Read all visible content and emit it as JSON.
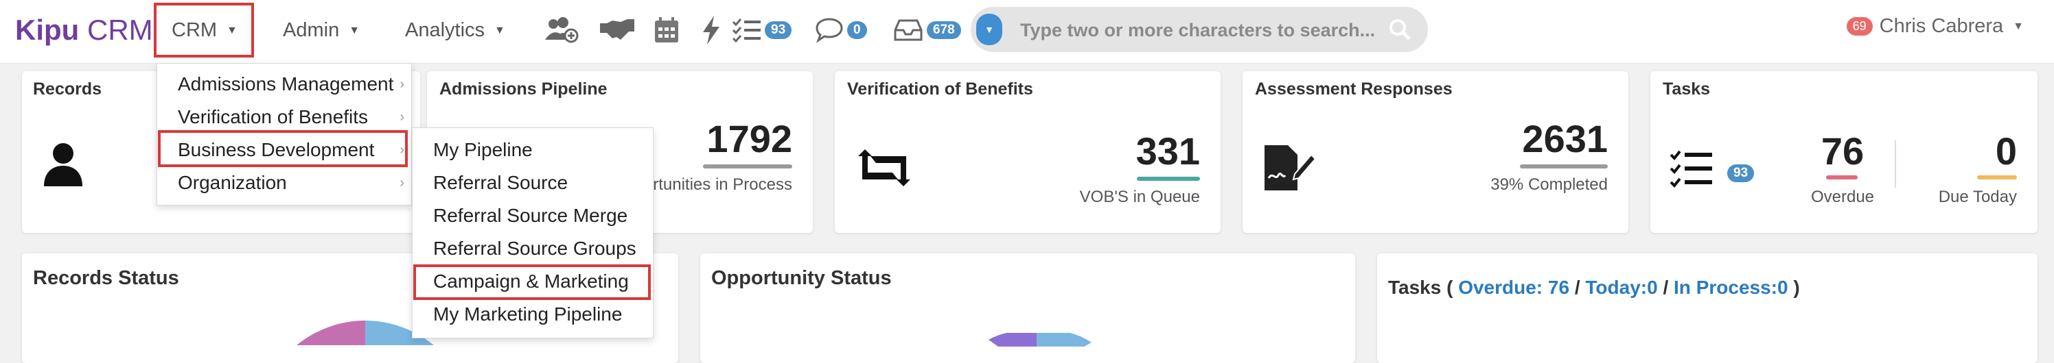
{
  "brand": {
    "name_bold": "Kipu",
    "name_rest": " CRM"
  },
  "nav": {
    "crm": "CRM",
    "admin": "Admin",
    "analytics": "Analytics"
  },
  "toolbar": {
    "tasks_count": "93",
    "messages_count": "0",
    "inbox_count": "678"
  },
  "search": {
    "placeholder": "Type two or more characters to search..."
  },
  "user": {
    "name": "Chris Cabrera",
    "notifications": "69"
  },
  "crm_menu": {
    "items": [
      {
        "label": "Admissions Management"
      },
      {
        "label": "Verification of Benefits"
      },
      {
        "label": "Business Development"
      },
      {
        "label": "Organization"
      }
    ]
  },
  "bizdev_menu": {
    "items": [
      {
        "label": "My Pipeline"
      },
      {
        "label": "Referral Source"
      },
      {
        "label": "Referral Source Merge"
      },
      {
        "label": "Referral Source Groups"
      },
      {
        "label": "Campaign & Marketing"
      },
      {
        "label": "My Marketing Pipeline"
      }
    ]
  },
  "cards": {
    "records": {
      "title": "Records"
    },
    "admissions": {
      "title": "Admissions Pipeline",
      "value": "1792",
      "sub": "Opportunities in Process"
    },
    "vob": {
      "title": "Verification of Benefits",
      "value": "331",
      "sub": "VOB'S in Queue"
    },
    "assessment": {
      "title": "Assessment Responses",
      "value": "2631",
      "sub": "39% Completed"
    },
    "tasks": {
      "title": "Tasks",
      "badge": "93",
      "overdue_value": "76",
      "overdue_label": "Overdue",
      "due_today_value": "0",
      "due_today_label": "Due Today"
    }
  },
  "panels": {
    "records_status": {
      "title": "Records Status"
    },
    "opportunity_status": {
      "title": "Opportunity Status"
    },
    "tasks_panel": {
      "prefix": "Tasks ( ",
      "overdue": "Overdue: 76",
      "sep1": " / ",
      "today": "Today:0",
      "sep2": " / ",
      "in_process": "In Process:0",
      "suffix": " )"
    }
  },
  "colors": {
    "brand": "#6f3fa0",
    "highlight": "#d9383a",
    "badge_blue": "#4a90c7",
    "vob_underline": "#4aa8a0",
    "overdue_underline": "#e06b7a",
    "due_today_underline": "#f0b95a",
    "link": "#2b7bbd"
  }
}
